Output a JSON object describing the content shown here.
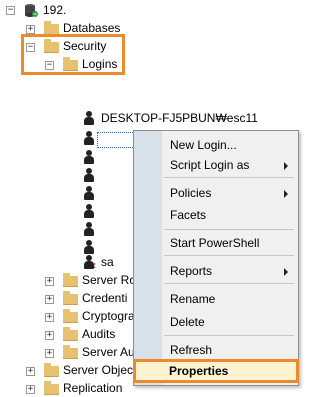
{
  "tree": {
    "server_node": "192.",
    "databases": "Databases",
    "security": "Security",
    "logins": "Logins",
    "login_selected": "DESKTOP-FJ5PBUN₩esc11",
    "login_sa": "sa",
    "server_roles": "Server Ro",
    "credentials": "Credenti",
    "cryptographic": "Cryptogra",
    "audits": "Audits",
    "server_audit_specs": "Server Au",
    "server_objects": "Server Object",
    "replication": "Replication"
  },
  "context_menu": {
    "new_login": "New Login...",
    "script_login_as": "Script Login as",
    "policies": "Policies",
    "facets": "Facets",
    "start_powershell": "Start PowerShell",
    "reports": "Reports",
    "rename": "Rename",
    "delete": "Delete",
    "refresh": "Refresh",
    "properties": "Properties"
  },
  "colors": {
    "highlight_border": "#ec8a2e",
    "menu_background": "#f0f0f0",
    "menu_gutter": "#d8e0ea"
  }
}
